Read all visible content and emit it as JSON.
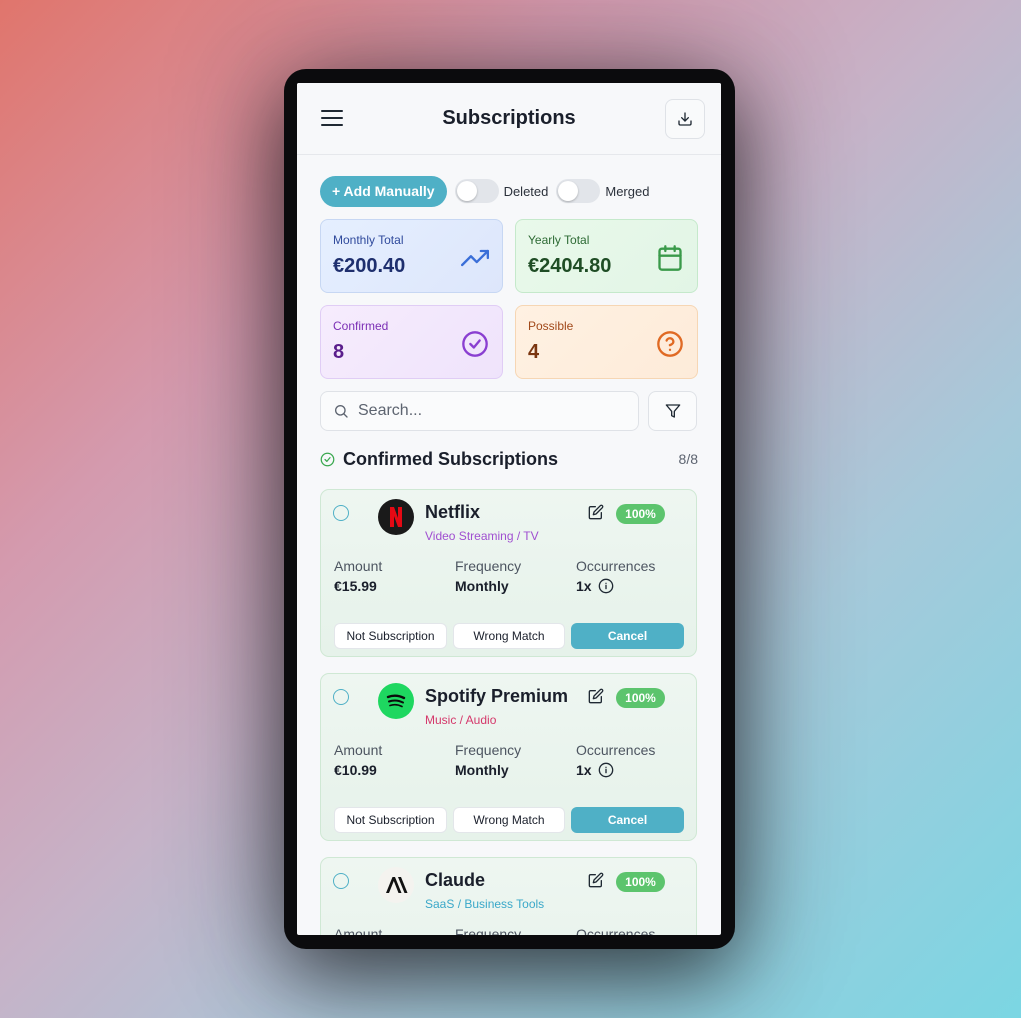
{
  "header": {
    "title": "Subscriptions",
    "menu_icon": "hamburger-menu-icon",
    "download_icon": "download-icon"
  },
  "controls": {
    "add_label": "+ Add Manually",
    "toggles": [
      {
        "label": "Deleted",
        "on": false
      },
      {
        "label": "Merged",
        "on": false
      }
    ]
  },
  "stats": [
    {
      "label": "Monthly Total",
      "value": "€200.40",
      "icon": "trending-up-icon",
      "color": "#3b6fd8"
    },
    {
      "label": "Yearly Total",
      "value": "€2404.80",
      "icon": "calendar-icon",
      "color": "#3a9a4a"
    },
    {
      "label": "Confirmed",
      "value": "8",
      "icon": "check-circle-icon",
      "color": "#8a3fd1"
    },
    {
      "label": "Possible",
      "value": "4",
      "icon": "help-circle-icon",
      "color": "#e06a24"
    }
  ],
  "search": {
    "placeholder": "Search..."
  },
  "section": {
    "title": "Confirmed Subscriptions",
    "count": "8/8"
  },
  "labels": {
    "amount": "Amount",
    "frequency": "Frequency",
    "occurrences": "Occurrences"
  },
  "cards": [
    {
      "name": "Netflix",
      "category": "Video Streaming / TV",
      "category_color": "#a04fd0",
      "confidence": "100%",
      "amount": "€15.99",
      "frequency": "Monthly",
      "occurrences": "1x",
      "logo": "netflix-logo",
      "actions": [
        "Not Subscription",
        "Wrong Match",
        "Cancel"
      ]
    },
    {
      "name": "Spotify Premium",
      "category": "Music / Audio",
      "category_color": "#d5386b",
      "confidence": "100%",
      "amount": "€10.99",
      "frequency": "Monthly",
      "occurrences": "1x",
      "logo": "spotify-logo",
      "actions": [
        "Not Subscription",
        "Wrong Match",
        "Cancel"
      ]
    },
    {
      "name": "Claude",
      "category": "SaaS / Business Tools",
      "category_color": "#3aa8c9",
      "confidence": "100%",
      "logo": "claude-logo"
    }
  ]
}
